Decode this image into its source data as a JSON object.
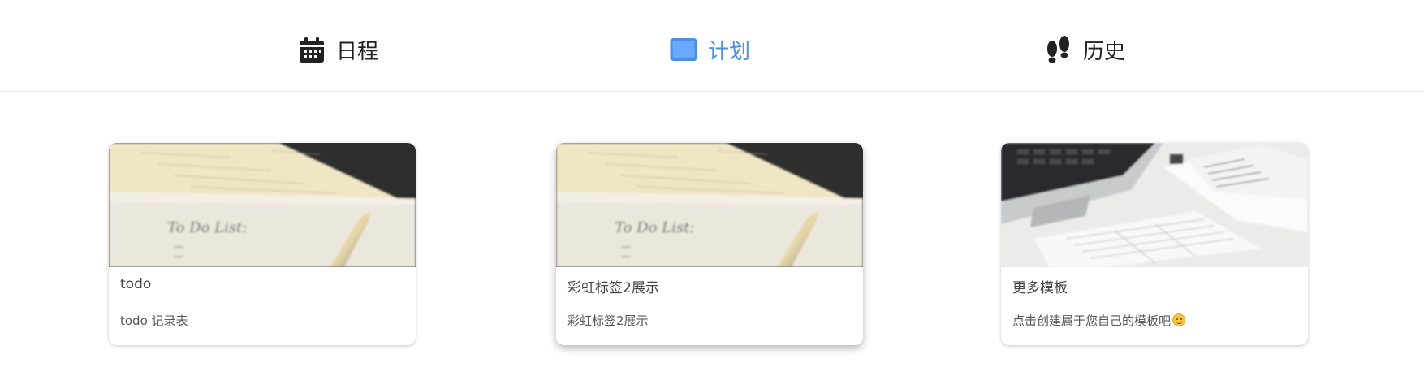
{
  "nav": {
    "items": [
      {
        "label": "日程",
        "icon": "calendar-icon",
        "active": false
      },
      {
        "label": "计划",
        "icon": "window-icon",
        "active": true
      },
      {
        "label": "历史",
        "icon": "footprints-icon",
        "active": false
      }
    ],
    "active_color": "#4a90e2"
  },
  "cards": [
    {
      "title": "todo",
      "desc": "todo 记录表",
      "image": "todo-list-photo"
    },
    {
      "title": "彩虹标签2展示",
      "desc": "彩虹标签2展示",
      "image": "todo-list-photo"
    },
    {
      "title": "更多模板",
      "desc": "点击创建属于您自己的模板吧",
      "image": "laptop-documents-photo",
      "desc_icon": "smiley-emoji-icon"
    }
  ]
}
